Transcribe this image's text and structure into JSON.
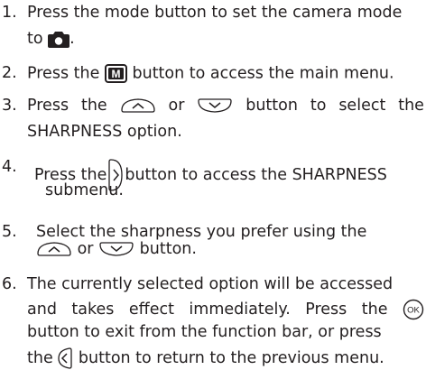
{
  "steps": [
    {
      "num": "1.",
      "l1": "Press the mode button to set the camera mode",
      "l2a": "to",
      "l2b": "."
    },
    {
      "num": "2.",
      "a": "Press the",
      "menu_glyph": "M",
      "b": "button to access the main menu."
    },
    {
      "num": "3.",
      "a": "Press the",
      "or": "or",
      "b": "button to select the",
      "l2": "SHARPNESS option."
    },
    {
      "num": "4.",
      "a": "Press the",
      "b": "button to access the SHARPNESS",
      "l2": "submenu."
    },
    {
      "num": "5.",
      "l1": "Select the sharpness you prefer using the",
      "or": "or",
      "b": "button."
    },
    {
      "num": "6.",
      "l1": "The currently selected option will be accessed",
      "l2": "and takes effect immediately. Press the",
      "ok_glyph": "OK",
      "l3": "button to exit from the function bar, or press",
      "l4a": "the",
      "l4b": "button to return to the previous menu."
    }
  ],
  "icons": {
    "camera": "camera-icon",
    "menu": "menu-m-icon",
    "up": "up-button-icon",
    "down": "down-button-icon",
    "right": "right-button-icon",
    "ok": "ok-button-icon",
    "left": "left-button-icon"
  }
}
